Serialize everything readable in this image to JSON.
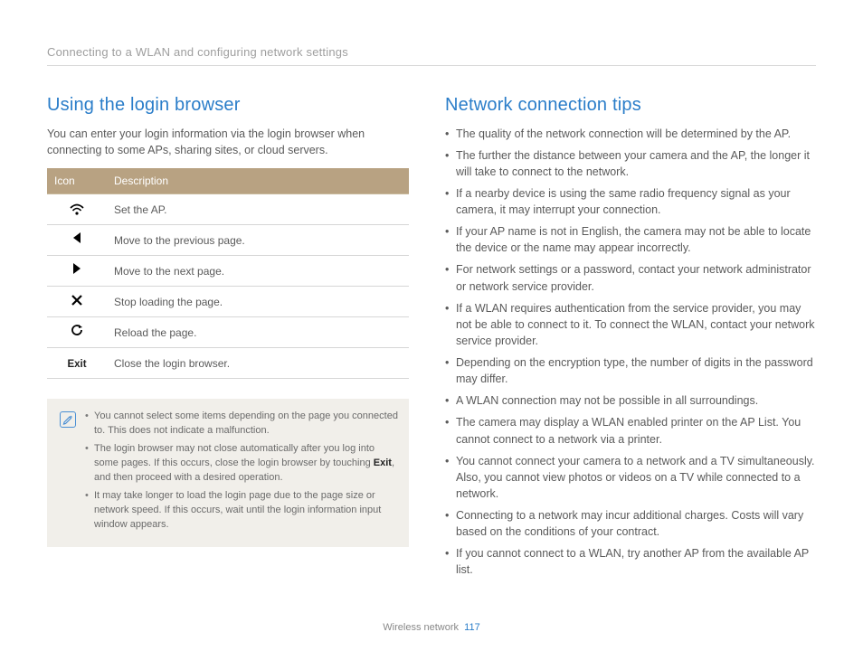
{
  "breadcrumb": "Connecting to a WLAN and configuring network settings",
  "left": {
    "title": "Using the login browser",
    "intro": "You can enter your login information via the login browser when connecting to some APs, sharing sites, or cloud servers.",
    "table": {
      "head_icon": "Icon",
      "head_desc": "Description",
      "rows": [
        {
          "icon": "wifi",
          "desc": "Set the AP."
        },
        {
          "icon": "back",
          "desc": "Move to the previous page."
        },
        {
          "icon": "fwd",
          "desc": "Move to the next page."
        },
        {
          "icon": "stop",
          "desc": "Stop loading the page."
        },
        {
          "icon": "reload",
          "desc": "Reload the page."
        },
        {
          "icon": "exit",
          "label": "Exit",
          "desc": "Close the login browser."
        }
      ]
    },
    "notes": [
      "You cannot select some items depending on the page you connected to. This does not indicate a malfunction.",
      "The login browser may not close automatically after you log into some pages. If this occurs, close the login browser by touching ",
      ", and then proceed with a desired operation.",
      "It may take longer to load the login page due to the page size or network speed. If this occurs, wait until the login information input window appears."
    ],
    "exit_inline": "Exit"
  },
  "right": {
    "title": "Network connection tips",
    "tips": [
      "The quality of the network connection will be determined by the AP.",
      "The further the distance between your camera and the AP, the longer it will take to connect to the network.",
      "If a nearby device is using the same radio frequency signal as your camera, it may interrupt your connection.",
      "If your AP name is not in English, the camera may not be able to locate the device or the name may appear incorrectly.",
      "For network settings or a password, contact your network administrator or network service provider.",
      "If a WLAN requires authentication from the service provider, you may not be able to connect to it. To connect the WLAN, contact your network service provider.",
      "Depending on the encryption type, the number of digits in the password may differ.",
      "A WLAN connection may not be possible in all surroundings.",
      "The camera may display a WLAN enabled printer on the AP List. You cannot connect to a network via a printer.",
      "You cannot connect your camera to a network and a TV simultaneously. Also, you cannot view photos or videos on a TV while connected to a network.",
      "Connecting to a network may incur additional charges. Costs will vary based on the conditions of your contract.",
      "If you cannot connect to a WLAN, try another AP from the available AP list."
    ]
  },
  "footer": {
    "section": "Wireless network",
    "page": "117"
  }
}
